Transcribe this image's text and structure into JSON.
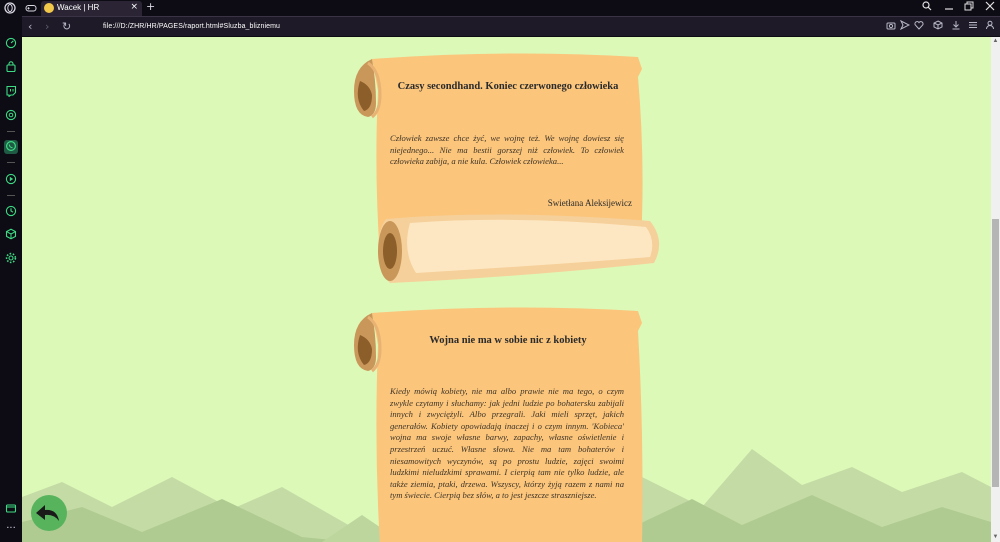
{
  "browser": {
    "tab": {
      "title": "Wacek | HR",
      "close": "×"
    },
    "new_tab": "+",
    "url": "file:///D:/ZHR/HR/PAGES/raport.html#Sluzba_blizniemu",
    "window_controls": {
      "search": "🔍",
      "minimize": "_",
      "restore": "❐",
      "close": "✕"
    },
    "nav": {
      "back": "‹",
      "forward": "›",
      "reload": "↻"
    },
    "toolbar_icons": [
      "camera-icon",
      "send-icon",
      "heart-icon",
      "download-icon",
      "cube-icon",
      "download-icon",
      "menu-icon",
      "user-icon"
    ]
  },
  "sidebar": {
    "icons": [
      "opera-logo-icon",
      "speed-dial-icon",
      "bag-icon",
      "twitch-icon",
      "chatgpt-icon",
      "whatsapp-icon",
      "music-icon",
      "history-icon",
      "cube-icon",
      "settings-icon",
      "wallet-icon",
      "more-icon"
    ],
    "more": "···"
  },
  "colors": {
    "page_bg": "#dcf9b7",
    "scroll_paper": "#fbc57c",
    "back_button": "#57b45d",
    "mountain": "#b4d09a"
  },
  "scroll1": {
    "title": "Czasy secondhand. Koniec czerwonego człowieka",
    "text": "Człowiek zawsze chce żyć, we wojnę też. We wojnę dowiesz się niejednego... Nie ma bestii gorszej niż człowiek. To człowiek człowieka zabija, a nie kula. Człowiek człowieka...",
    "author": "Swietłana Aleksijewicz"
  },
  "scroll2": {
    "title": "Wojna nie ma w sobie nic z kobiety",
    "text": "Kiedy mówią kobiety, nie ma albo prawie nie ma tego, o czym zwykle czytamy i słuchamy: jak jedni ludzie po bohatersku zabijali innych i zwyciężyli. Albo przegrali. Jaki mieli sprzęt, jakich generałów. Kobiety opowiadają inaczej i o czym innym. 'Kobieca' wojna ma swoje własne barwy, zapachy, własne oświetlenie i przestrzeń uczuć. Własne słowa. Nie ma tam bohaterów i niesamowitych wyczynów, są po prostu ludzie, zajęci swoimi ludzkimi nieludzkimi sprawami. I cierpią tam nie tylko ludzie, ale także ziemia, ptaki, drzewa. Wszyscy, którzy żyją razem z nami na tym świecie. Cierpią bez słów, a to jest jeszcze straszniejsze."
  },
  "back_button": {
    "icon": "back-arrow-icon"
  }
}
